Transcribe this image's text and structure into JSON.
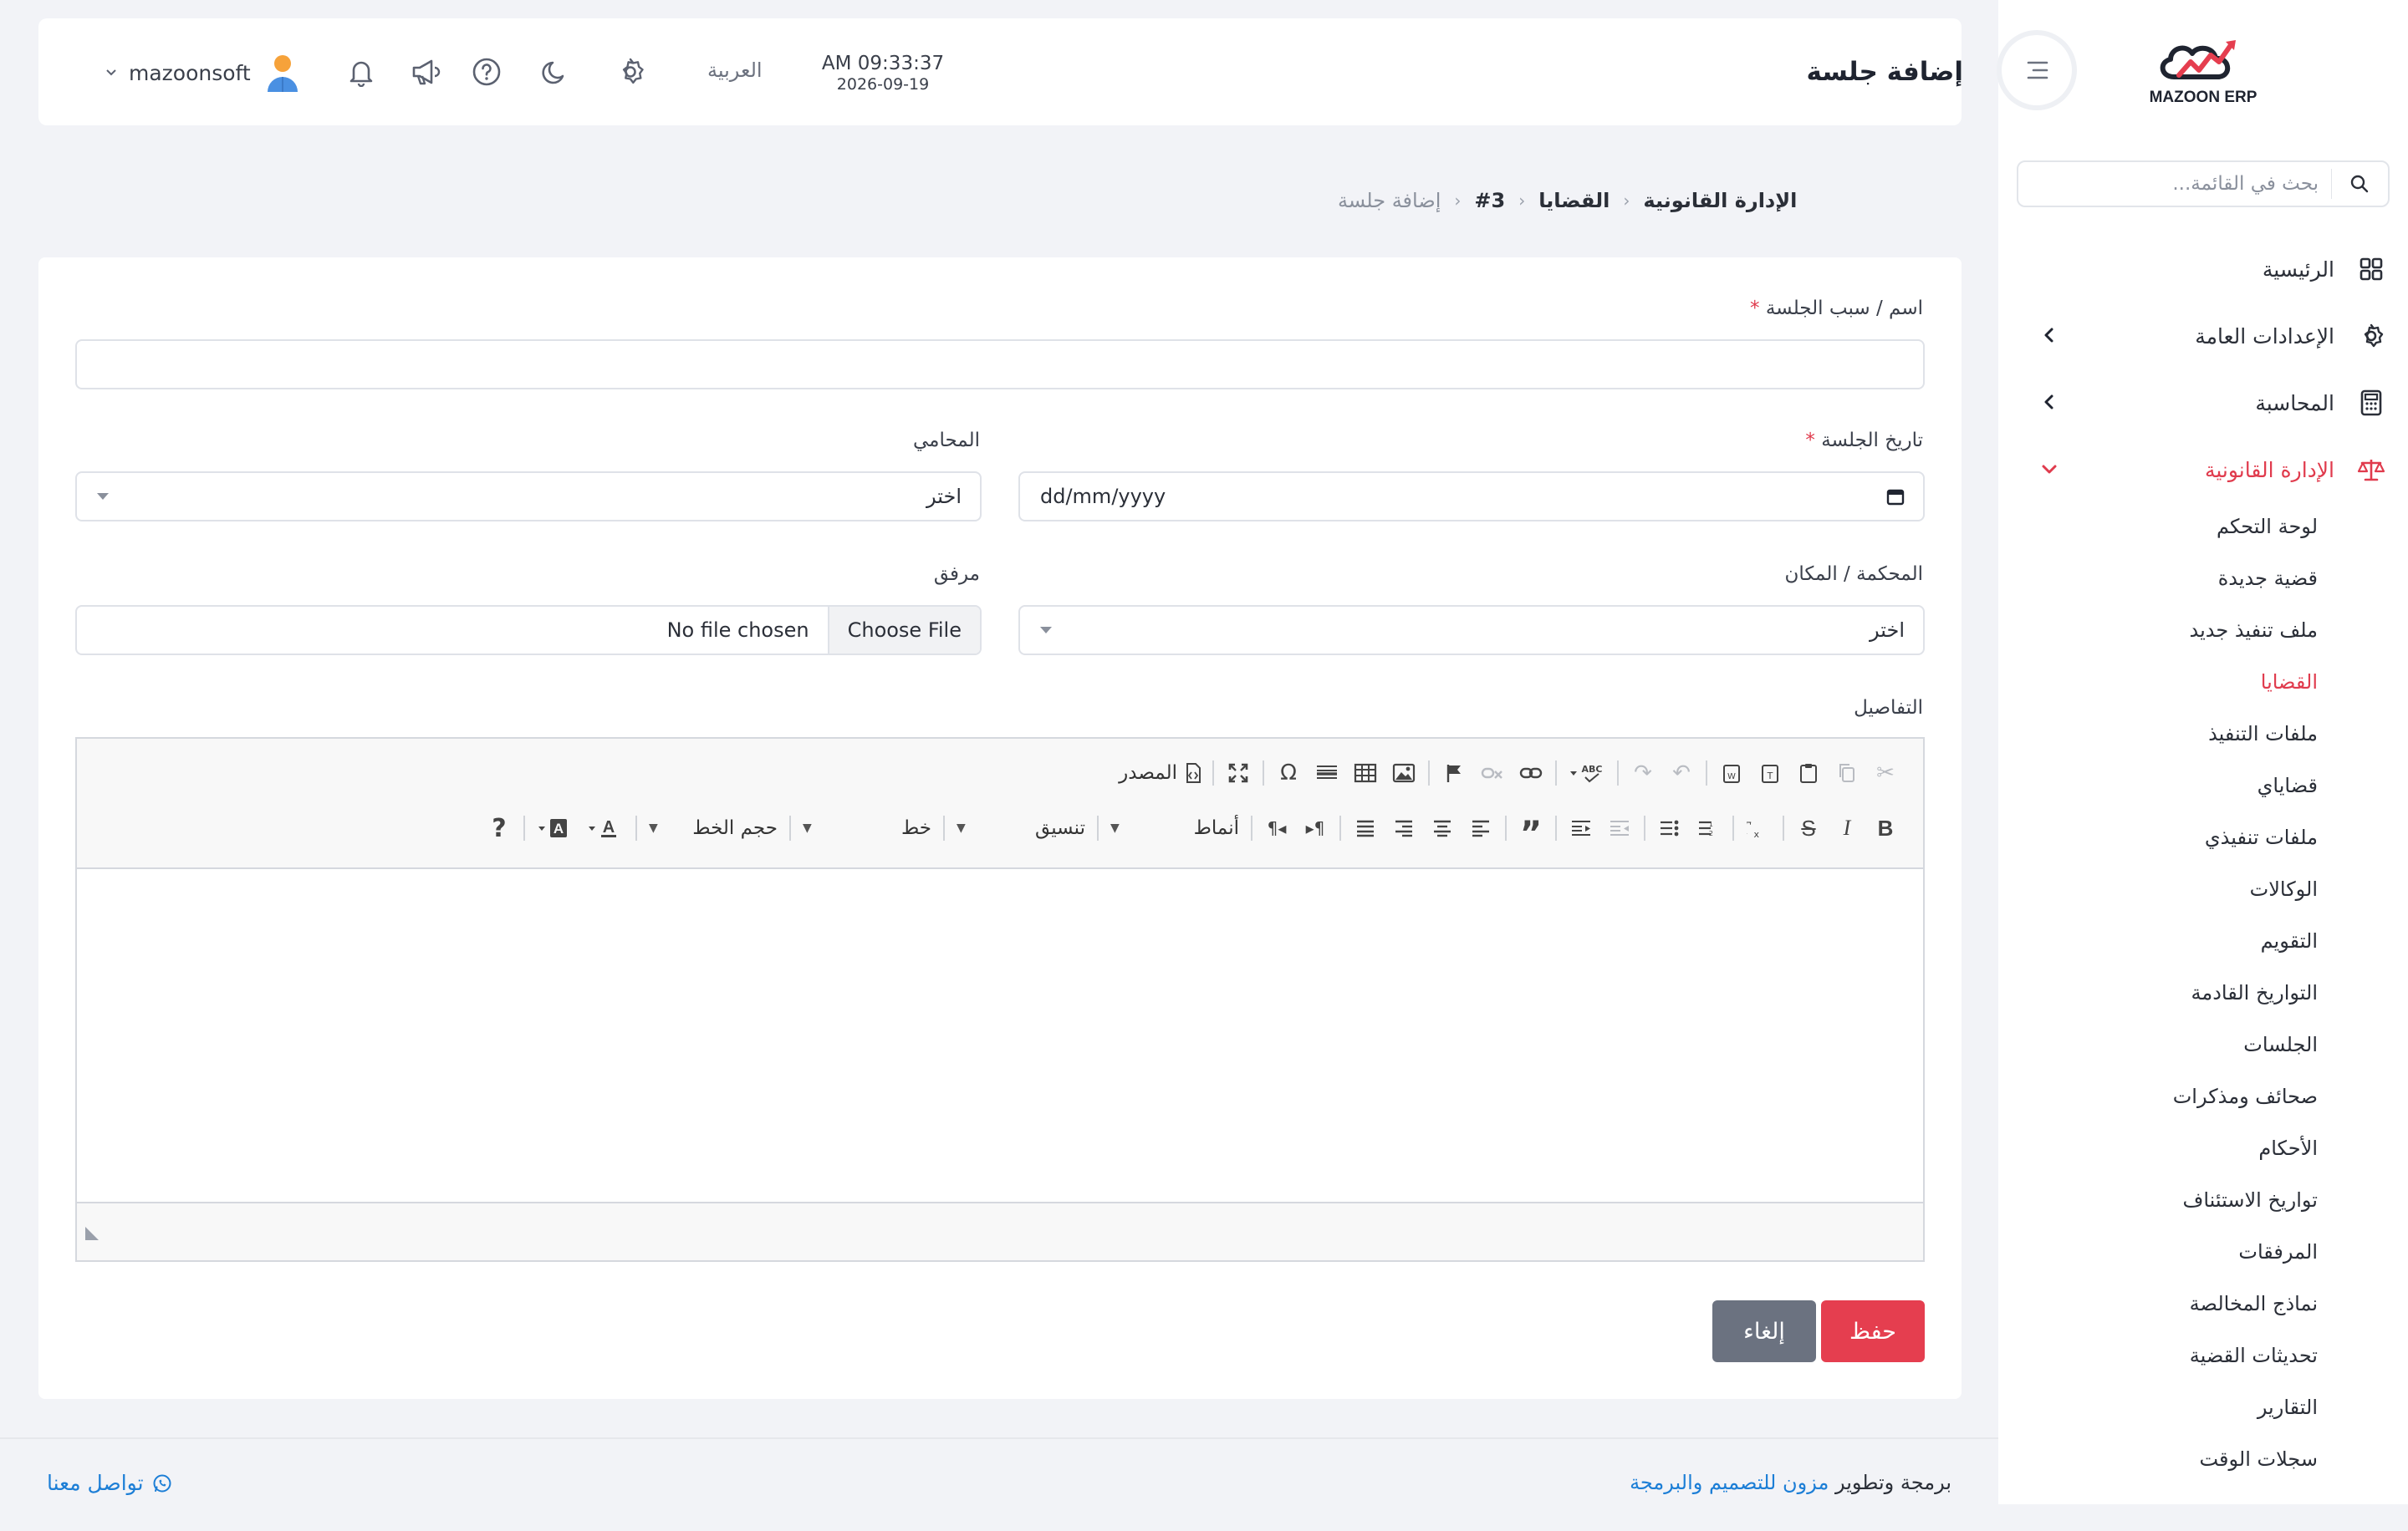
{
  "brand": {
    "logo_text": "MAZOON ERP",
    "logo_subtext": "ERP"
  },
  "sidebar": {
    "search_placeholder": "بحث في القائمة...",
    "items": [
      {
        "label": "الرئيسية",
        "icon": "grid-icon"
      },
      {
        "label": "الإعدادات العامة",
        "icon": "gear-icon"
      },
      {
        "label": "المحاسبة",
        "icon": "calculator-icon"
      },
      {
        "label": "الإدارة القانونية",
        "icon": "scales-icon",
        "active": true
      }
    ],
    "sub_items": [
      {
        "label": "لوحة التحكم"
      },
      {
        "label": "قضية جديدة"
      },
      {
        "label": "ملف تنفيذ جديد"
      },
      {
        "label": "القضايا",
        "active": true
      },
      {
        "label": "ملفات التنفيذ"
      },
      {
        "label": "قضاياي"
      },
      {
        "label": "ملفات تنفيذي"
      },
      {
        "label": "الوكالات"
      },
      {
        "label": "التقويم"
      },
      {
        "label": "التواريخ القادمة"
      },
      {
        "label": "الجلسات"
      },
      {
        "label": "صحائف ومذكرات"
      },
      {
        "label": "الأحكام"
      },
      {
        "label": "تواريخ الاستئناف"
      },
      {
        "label": "المرفقات"
      },
      {
        "label": "نماذج المخالصة"
      },
      {
        "label": "تحديثات القضية"
      },
      {
        "label": "التقارير"
      },
      {
        "label": "سجلات الوقت"
      }
    ]
  },
  "header": {
    "title": "إضافة جلسة",
    "time": "AM 09:33:37",
    "date": "2026-09-19",
    "language": "العربية",
    "username": "mazoonsoft"
  },
  "breadcrumb": [
    "الإدارة القانونية",
    "القضايا",
    "#3",
    "إضافة جلسة"
  ],
  "form": {
    "session_name_label": "اسم / سبب الجلسة",
    "required_mark": "*",
    "session_date_label": "تاريخ الجلسة",
    "session_date_placeholder": "dd/mm/yyyy",
    "lawyer_label": "المحامي",
    "lawyer_value": "اختر",
    "court_label": "المحكمة / المكان",
    "court_value": "اختر",
    "attachment_label": "مرفق",
    "file_button": "Choose File",
    "file_status": "No file chosen",
    "details_label": "التفاصيل"
  },
  "editor": {
    "source_label": "المصدر",
    "styles_label": "أنماط",
    "format_label": "تنسيق",
    "font_label": "خط",
    "size_label": "حجم الخط",
    "help_label": "?"
  },
  "actions": {
    "save": "حفظ",
    "cancel": "إلغاء"
  },
  "footer": {
    "credit_prefix": "برمجة وتطوير",
    "credit_link": "مزون للتصميم والبرمجة",
    "contact": "تواصل معنا"
  },
  "colors": {
    "accent": "#e53e4f",
    "link": "#1c7ed6",
    "cancel": "#6b7280"
  }
}
